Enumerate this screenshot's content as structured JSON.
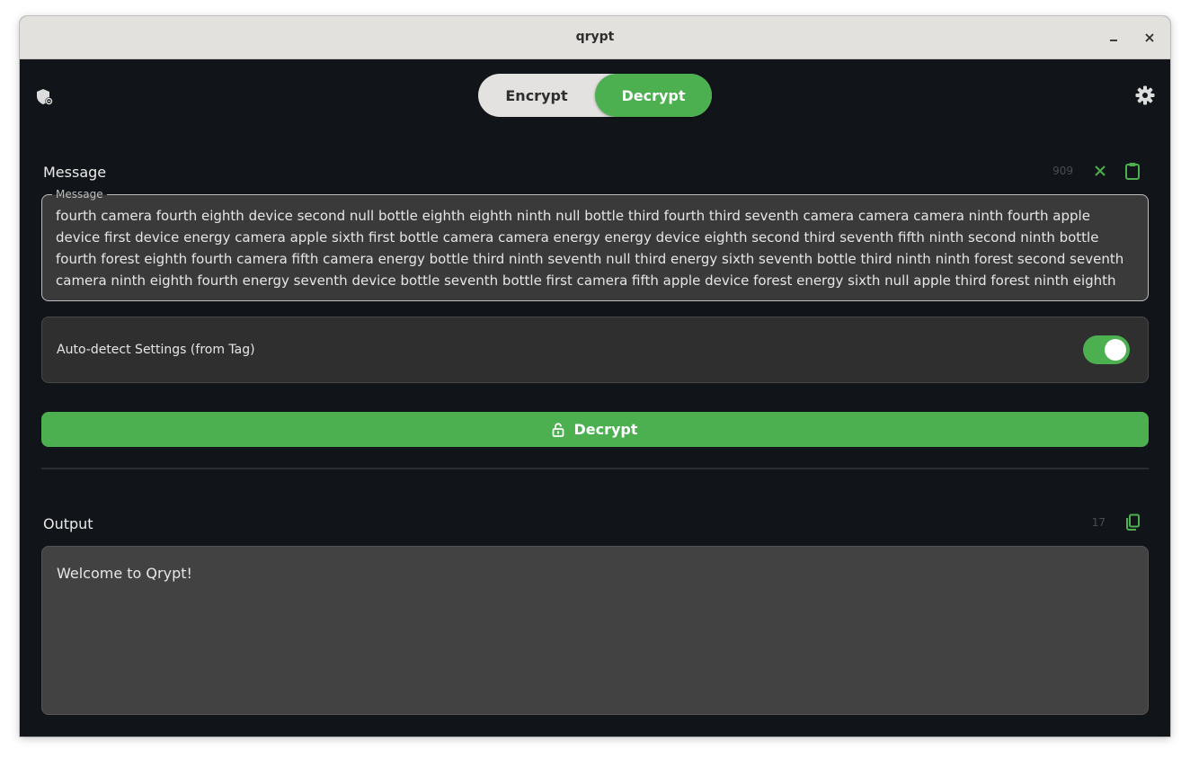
{
  "window": {
    "title": "qrypt"
  },
  "mode": {
    "encrypt_label": "Encrypt",
    "decrypt_label": "Decrypt",
    "active": "Decrypt"
  },
  "message": {
    "label": "Message",
    "count": "909",
    "field_legend": "Message",
    "value": "fourth camera fourth eighth device second null bottle eighth eighth ninth null bottle third fourth third seventh camera camera camera ninth fourth apple device first device energy camera apple sixth first bottle camera camera energy energy device eighth second third seventh fifth ninth second ninth bottle fourth forest eighth fourth camera fifth camera energy bottle third ninth seventh null third energy sixth seventh bottle third ninth ninth forest second seventh camera ninth eighth fourth energy seventh device bottle seventh bottle first camera fifth apple device forest energy sixth null apple third forest ninth eighth"
  },
  "auto_detect": {
    "label": "Auto-detect Settings (from Tag)",
    "enabled": true
  },
  "action": {
    "decrypt_label": "Decrypt"
  },
  "output": {
    "label": "Output",
    "count": "17",
    "value": "Welcome to Qrypt!"
  },
  "colors": {
    "accent": "#4caf50",
    "background": "#111519",
    "titlebar": "#e3e1de"
  },
  "icons": {
    "left_header": "shield-icon",
    "right_header": "gear-icon",
    "clear": "close-x-icon",
    "paste": "clipboard-icon",
    "copy": "copy-icon",
    "action": "lock-icon"
  }
}
